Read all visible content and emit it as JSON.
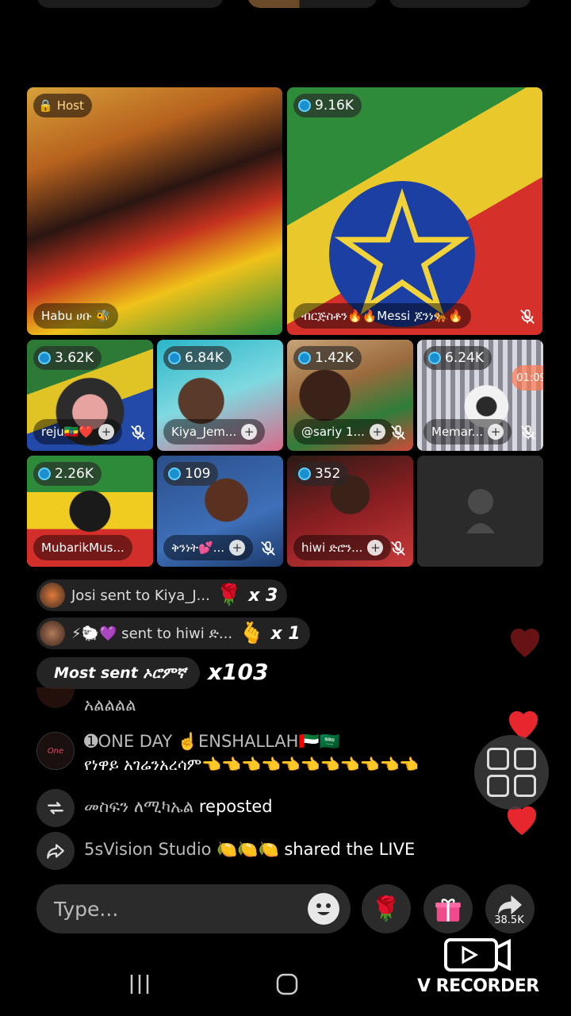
{
  "tiles": [
    {
      "badge": "Host",
      "name": "Habu ሀቡ 🐝"
    },
    {
      "badge": "9.16K",
      "name": "ብርጅስቶን🔥🔥Messi ጆንነ🐅🔥"
    },
    {
      "badge": "3.62K",
      "name": "reju🇪🇹❤️"
    },
    {
      "badge": "6.84K",
      "name": "Kiya_Jem..."
    },
    {
      "badge": "1.42K",
      "name": "@sariy 1..."
    },
    {
      "badge": "6.24K",
      "name": "Memar..."
    },
    {
      "badge": "2.26K",
      "name": "MubarikMus..."
    },
    {
      "badge": "109",
      "name": "ቅንነት💕..."
    },
    {
      "badge": "352",
      "name": "hiwi ድሮን..."
    }
  ],
  "timer": "01:09",
  "gifts": [
    {
      "text": "Josi sent to Kiya_J...",
      "count": "x 3"
    },
    {
      "text": "⚡🐑💜 sent to hiwi ድ...",
      "count": "x 1"
    }
  ],
  "most_sent": {
    "label": "Most sent ኦሮምኛ",
    "count": "x103"
  },
  "chat": {
    "line1": "አልልልል",
    "user2": "➊ONE DAY ☝️ENSHALLAH🇦🇪🇸🇦",
    "msg2": "የነዋይ አገሬንአረሳም👈👈👈👈👈👈👈👈👈👈👈",
    "repost_user": "መስፍን ለሚካኤል",
    "repost_action": "reposted",
    "share_user": "5sVision Studio 🍋🍋🍋",
    "share_action": "shared the LIVE"
  },
  "input": {
    "placeholder": "Type..."
  },
  "share_count": "38.5K",
  "recorder_label": "V RECORDER",
  "colors": {
    "heart": "#e8262d",
    "badge_dot": "#1a8fd0"
  }
}
